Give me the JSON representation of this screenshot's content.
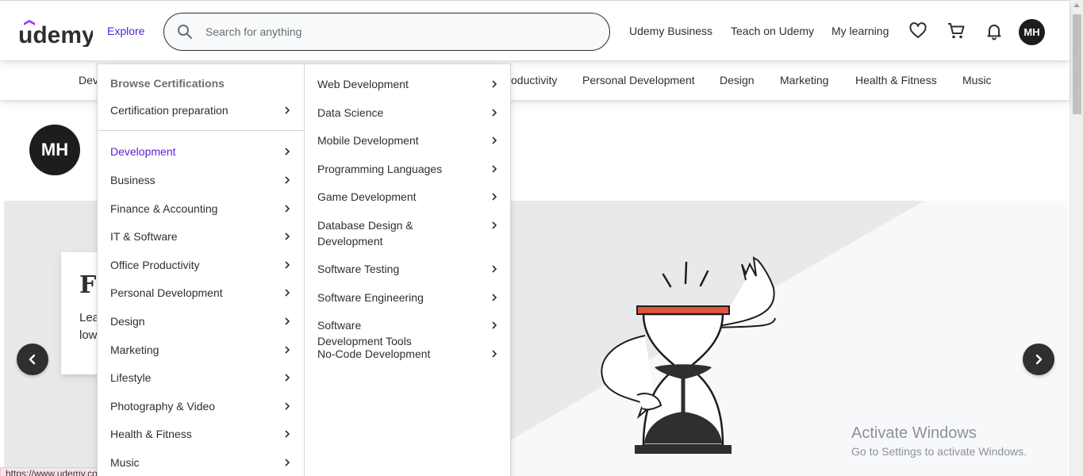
{
  "header": {
    "logo_text": "ūdemy",
    "explore": "Explore",
    "search_placeholder": "Search for anything",
    "links": [
      "Udemy Business",
      "Teach on Udemy",
      "My learning"
    ],
    "avatar_initials": "MH",
    "icons": [
      "search-icon",
      "heart-icon",
      "cart-icon",
      "bell-icon"
    ]
  },
  "category_bar": {
    "items": [
      "Dev",
      "oductivity",
      "Personal Development",
      "Design",
      "Marketing",
      "Health & Fitness",
      "Music"
    ]
  },
  "profile": {
    "avatar_initials": "MH"
  },
  "promo": {
    "title": "F",
    "text_line1": "Lea",
    "text_line2": "low"
  },
  "menu": {
    "heading": "Browse Certifications",
    "cert_item": "Certification preparation",
    "categories": [
      "Development",
      "Business",
      "Finance & Accounting",
      "IT & Software",
      "Office Productivity",
      "Personal Development",
      "Design",
      "Marketing",
      "Lifestyle",
      "Photography & Video",
      "Health & Fitness",
      "Music"
    ],
    "active_category": "Development",
    "subcategories": [
      "Web Development",
      "Data Science",
      "Mobile Development",
      "Programming Languages",
      "Game Development",
      "Database Design & Development",
      "Software Testing",
      "Software Engineering",
      "Software Development Tools",
      "No-Code Development"
    ]
  },
  "watermark": {
    "line1": "Activate Windows",
    "line2": "Go to Settings to activate Windows."
  },
  "status_url": "https://www.udemy.com/courses/development/",
  "colors": {
    "accent": "#5624d0",
    "dark": "#2d2f31",
    "hourglass_red": "#e5533c"
  }
}
